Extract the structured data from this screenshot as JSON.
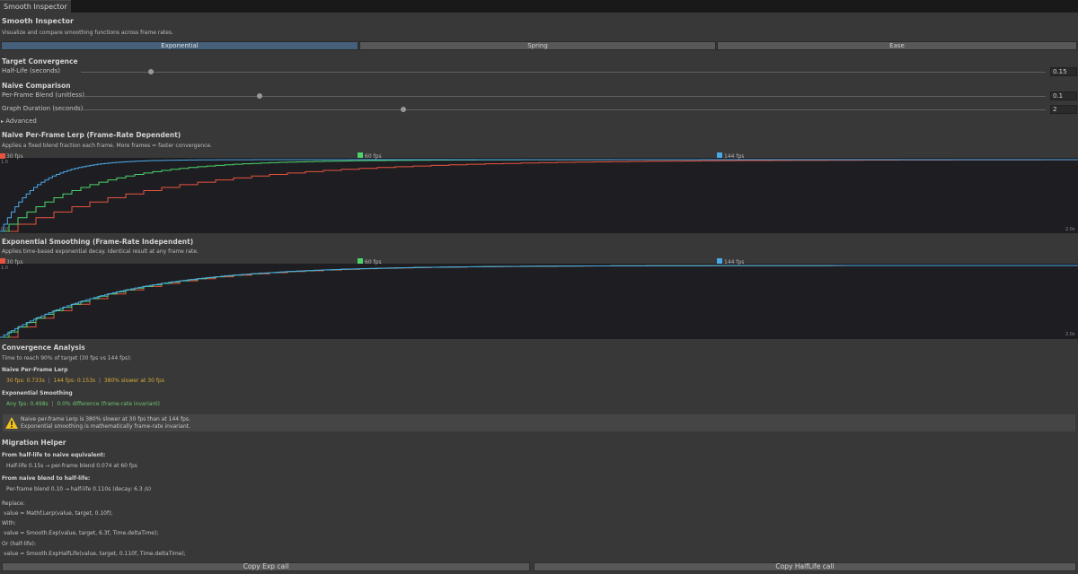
{
  "window": {
    "tab_label": "Smooth Inspector"
  },
  "header": {
    "title": "Smooth Inspector",
    "subtitle": "Visualize and compare smoothing functions across frame rates."
  },
  "modes": {
    "options": [
      "Exponential",
      "Spring",
      "Ease"
    ],
    "selected": "Exponential"
  },
  "target": {
    "heading": "Target Convergence",
    "half_life": {
      "label": "Half-Life (seconds)",
      "value": "0.15",
      "fraction": 0.07
    }
  },
  "naive": {
    "heading": "Naive Comparison",
    "blend": {
      "label": "Per-Frame Blend (unitless)",
      "value": "0.1",
      "fraction": 0.18
    },
    "duration": {
      "label": "Graph Duration (seconds)",
      "value": "2",
      "fraction": 0.33
    },
    "advanced_label": "Advanced"
  },
  "graph_naive": {
    "title": "Naive Per-Frame Lerp (Frame-Rate Dependent)",
    "subtitle": "Applies a fixed blend fraction each frame. More frames = faster convergence.",
    "y_top": "1.0",
    "y_bottom": "0.0",
    "x_end": "2.0s"
  },
  "graph_exp": {
    "title": "Exponential Smoothing (Frame-Rate Independent)",
    "subtitle": "Applies time-based exponential decay. Identical result at any frame rate.",
    "y_top": "1.0",
    "y_bottom": "0.0",
    "x_end": "2.0s"
  },
  "legend": [
    {
      "name": "30 fps",
      "color": "#e8533f"
    },
    {
      "name": "60 fps",
      "color": "#4cd46a"
    },
    {
      "name": "144 fps",
      "color": "#4aa8e6"
    }
  ],
  "chart_data": [
    {
      "type": "line",
      "title": "Naive Per-Frame Lerp (Frame-Rate Dependent)",
      "xlim": [
        0,
        2
      ],
      "ylim": [
        0,
        1
      ],
      "series": [
        {
          "name": "30 fps",
          "model": "naive",
          "fps": 30,
          "blend": 0.1
        },
        {
          "name": "60 fps",
          "model": "naive",
          "fps": 60,
          "blend": 0.1
        },
        {
          "name": "144 fps",
          "model": "naive",
          "fps": 144,
          "blend": 0.1
        }
      ]
    },
    {
      "type": "line",
      "title": "Exponential Smoothing (Frame-Rate Independent)",
      "xlim": [
        0,
        2
      ],
      "ylim": [
        0,
        1
      ],
      "series": [
        {
          "name": "30 fps",
          "model": "exponential",
          "fps": 30,
          "half_life": 0.15
        },
        {
          "name": "60 fps",
          "model": "exponential",
          "fps": 60,
          "half_life": 0.15
        },
        {
          "name": "144 fps",
          "model": "exponential",
          "fps": 144,
          "half_life": 0.15
        }
      ]
    }
  ],
  "analysis": {
    "heading": "Convergence Analysis",
    "subtitle": "Time to reach 90% of target (30 fps vs 144 fps):",
    "naive_heading": "Naive Per-Frame Lerp",
    "naive_30": "30 fps: 0.733s",
    "naive_144": "144 fps: 0.153s",
    "naive_diff": "380% slower at 30 fps",
    "exp_heading": "Exponential Smoothing",
    "exp_any": "Any fps: 0.498s",
    "exp_diff": "0.0% difference (frame-rate invariant)",
    "warning_line1": "Naive per-frame Lerp is 380% slower at 30 fps than at 144 fps.",
    "warning_line2": "Exponential smoothing is mathematically frame-rate invariant."
  },
  "migration": {
    "heading": "Migration Helper",
    "from_hl_heading": "From half-life to naive equivalent:",
    "from_hl_line": "Half-life 0.15s  →  per-frame blend 0.074 at 60 fps",
    "from_blend_heading": "From naive blend to half-life:",
    "from_blend_line": "Per-frame blend 0.10  →  half-life 0.110s  (decay: 6.3 /s)",
    "replace_label": "Replace:",
    "replace_code": "value = Mathf.Lerp(value, target, 0.10f);",
    "with_label": "With:",
    "with_code": "value = Smooth.Exp(value, target, 6.3f, Time.deltaTime);",
    "or_label": "Or (half-life):",
    "or_code": "value = Smooth.ExpHalfLife(value, target, 0.110f, Time.deltaTime);",
    "copy_exp": "Copy Exp call",
    "copy_halflife": "Copy HalfLife call"
  }
}
